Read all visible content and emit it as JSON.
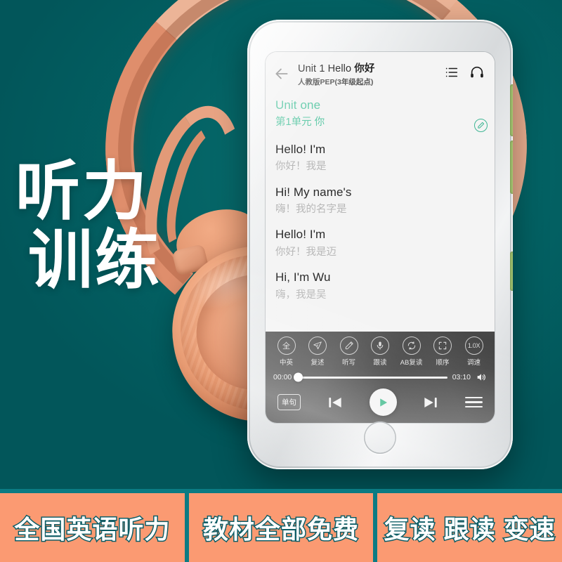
{
  "theme": {
    "background": "#026062",
    "headphone_color": "#eda178",
    "accent_green": "#5ec9a7",
    "play_green": "#2ab37f",
    "banner_bg": "#fb9a72",
    "banner_divider": "#0b7b83",
    "banner_stroke": "#0d5d66"
  },
  "headline": {
    "line1": "听力",
    "line2": "训练"
  },
  "phone": {
    "app_header": {
      "back_icon": "back-arrow-icon",
      "title_en": "Unit 1 Hello ",
      "title_cn": "你好",
      "subtitle": "人教版PEP(3年级起点)",
      "list_icon": "list-icon",
      "headphone_icon": "headphone-icon"
    },
    "lyrics": [
      {
        "en": "Unit one",
        "cn": "第1单元 你",
        "active": true,
        "edit_icon": "edit-pencil-icon"
      },
      {
        "en": "Hello! I'm",
        "cn": "你好！我是",
        "active": false
      },
      {
        "en": "Hi! My name's",
        "cn": "嗨！我的名字是",
        "active": false
      },
      {
        "en": "Hello! I'm",
        "cn": "你好！我是迈",
        "active": false
      },
      {
        "en": "Hi, I'm Wu",
        "cn": "嗨，我是吴",
        "active": false
      }
    ],
    "toolbar": [
      {
        "icon": "quan-circle-icon",
        "glyph": "全",
        "label": "中英"
      },
      {
        "icon": "airplane-icon",
        "glyph": "✈",
        "label": "复述"
      },
      {
        "icon": "pencil-icon",
        "glyph": "✎",
        "label": "听写"
      },
      {
        "icon": "microphone-icon",
        "glyph": "🎤",
        "label": "跟读"
      },
      {
        "icon": "ab-repeat-icon",
        "glyph": "↻",
        "label": "AB复读"
      },
      {
        "icon": "sequence-frame-icon",
        "glyph": "[ ]",
        "label": "顺序"
      },
      {
        "icon": "speed-icon",
        "glyph": "1.0X",
        "label": "调速"
      }
    ],
    "player": {
      "current_time": "00:00",
      "total_time": "03:10",
      "progress_percent": 0,
      "volume_icon": "volume-icon",
      "loop_label": "单句",
      "prev_icon": "previous-track-icon",
      "play_icon": "play-icon",
      "next_icon": "next-track-icon",
      "menu_icon": "hamburger-menu-icon"
    },
    "home_button": "home-button"
  },
  "banner": {
    "cells": [
      {
        "text": "全国英语听力"
      },
      {
        "text": "教材全部免费"
      },
      {
        "text": "复读 跟读 变速"
      }
    ]
  }
}
